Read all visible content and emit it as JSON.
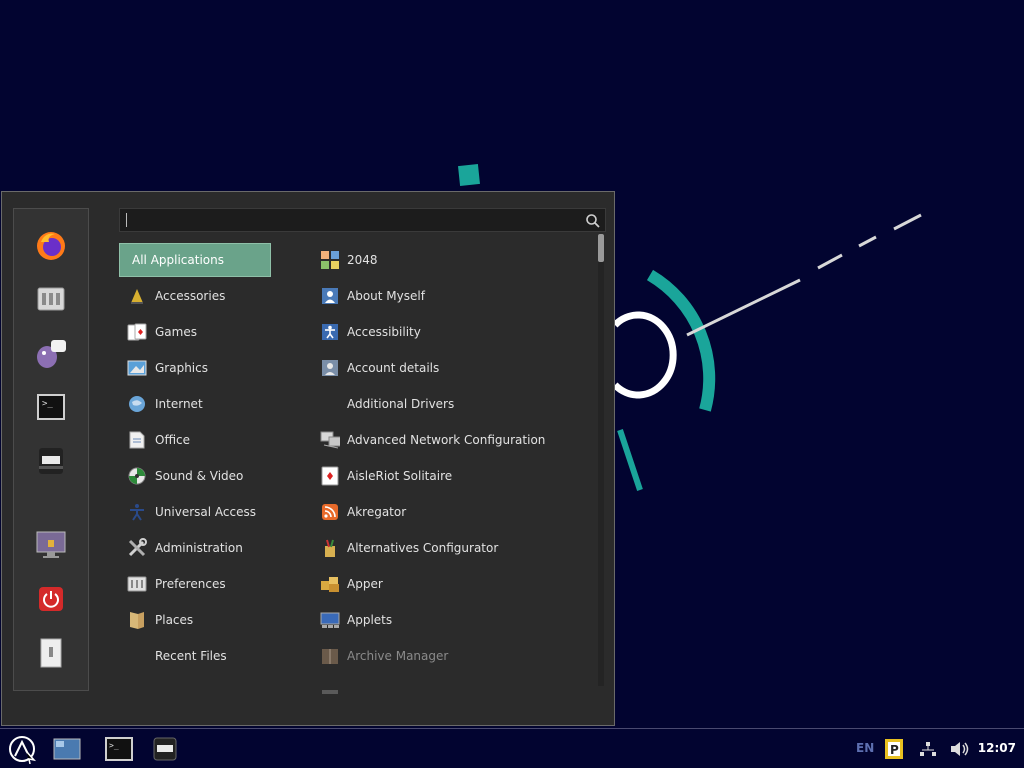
{
  "menu": {
    "search": {
      "value": "",
      "placeholder": ""
    },
    "favorites": [
      {
        "name": "firefox-icon"
      },
      {
        "name": "settings-icon"
      },
      {
        "name": "pidgin-icon"
      },
      {
        "name": "terminal-icon"
      },
      {
        "name": "files-icon"
      },
      {
        "name": "lock-screen-icon"
      },
      {
        "name": "quit-icon"
      },
      {
        "name": "logout-icon"
      }
    ],
    "categories": [
      {
        "label": "All Applications",
        "selected": true
      },
      {
        "label": "Accessories",
        "icon": "accessories-icon"
      },
      {
        "label": "Games",
        "icon": "games-icon"
      },
      {
        "label": "Graphics",
        "icon": "graphics-icon"
      },
      {
        "label": "Internet",
        "icon": "internet-icon"
      },
      {
        "label": "Office",
        "icon": "office-icon"
      },
      {
        "label": "Sound & Video",
        "icon": "sound-video-icon"
      },
      {
        "label": "Universal Access",
        "icon": "universal-access-icon"
      },
      {
        "label": "Administration",
        "icon": "administration-icon"
      },
      {
        "label": "Preferences",
        "icon": "preferences-icon"
      },
      {
        "label": "Places",
        "icon": "places-icon"
      },
      {
        "label": "Recent Files",
        "icon": ""
      }
    ],
    "apps": [
      {
        "label": "2048",
        "icon": "2048-icon"
      },
      {
        "label": "About Myself",
        "icon": "about-myself-icon"
      },
      {
        "label": "Accessibility",
        "icon": "accessibility-icon"
      },
      {
        "label": "Account details",
        "icon": "account-details-icon"
      },
      {
        "label": "Additional Drivers",
        "icon": ""
      },
      {
        "label": "Advanced Network Configuration",
        "icon": "network-config-icon"
      },
      {
        "label": "AisleRiot Solitaire",
        "icon": "solitaire-icon"
      },
      {
        "label": "Akregator",
        "icon": "rss-icon"
      },
      {
        "label": "Alternatives Configurator",
        "icon": "alternatives-icon"
      },
      {
        "label": "Apper",
        "icon": "apper-icon"
      },
      {
        "label": "Applets",
        "icon": "applets-icon"
      },
      {
        "label": "Archive Manager",
        "icon": "archive-manager-icon"
      }
    ]
  },
  "panel": {
    "language": "EN",
    "clock": "12:07"
  },
  "colors": {
    "desktop_bg": "#020430",
    "accent": "#1aa59a",
    "selected_bg": "#6aa38a",
    "menu_bg": "#2b2b2b"
  }
}
